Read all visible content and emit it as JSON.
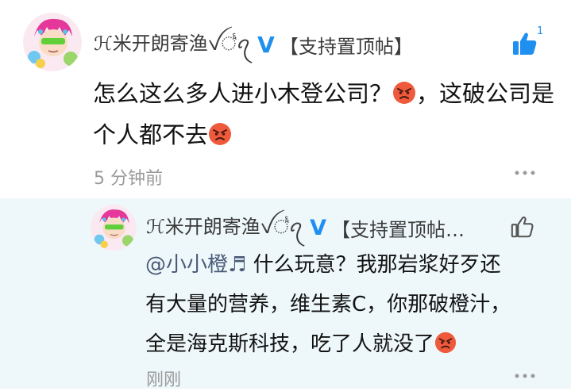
{
  "comment": {
    "username": "ℋ米开朗寄渔ꪜ꣦ꪖ",
    "vip_badge": "V",
    "tag": "【支持置顶帖】",
    "text_part1": "怎么这么多人进小木登公司？",
    "text_part2": "，这破公司是",
    "text_part3": "个人都不去",
    "emoji": "angry-face",
    "time": "5 分钟前",
    "like_count": "1",
    "like_icon": "thumbs-up-filled-icon",
    "more_icon": "more-dots-icon"
  },
  "reply": {
    "username": "ℋ米开朗寄渔ꪜ꣦ꪖ",
    "vip_badge": "V",
    "tag": "【支持置顶帖…",
    "mention": "@小小橙♬",
    "text_part1": " 什么玩意？我那岩浆好歹还",
    "text_part2": "有大量的营养，维生素C，你那破橙汁，",
    "text_part3": "全是海克斯科技，吃了人就没了",
    "emoji": "angry-face",
    "time": "刚刚",
    "like_icon": "thumbs-up-outline-icon",
    "more_icon": "more-dots-icon"
  },
  "colors": {
    "accent_blue": "#1f8ff0",
    "reply_background": "#eef8fa",
    "muted_text": "#9a9a9a",
    "body_text": "#121212"
  }
}
